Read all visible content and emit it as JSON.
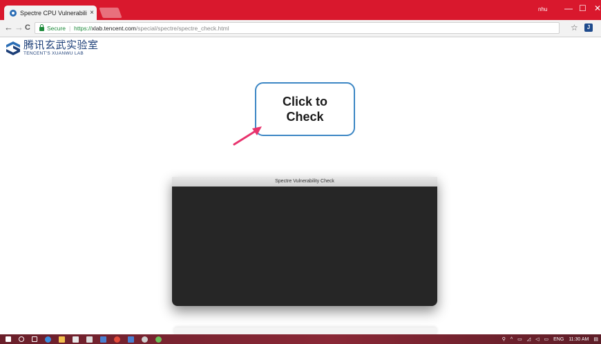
{
  "browser": {
    "tab_title": "Spectre CPU Vulnerabilit",
    "tab_close": "×",
    "user": "nhu",
    "minimize": "—",
    "maximize": "☐",
    "close": "✕",
    "nav": {
      "back": "←",
      "forward": "→",
      "reload": "C"
    },
    "secure_label": "Secure",
    "separator": "|",
    "url_scheme": "https://",
    "url_host": "xlab.tencent.com",
    "url_path": "/special/spectre/spectre_check.html",
    "star": "☆",
    "extension_label": "J"
  },
  "page": {
    "logo_cn": "腾讯玄武实验室",
    "logo_en": "TENCENT'S XUANWU LAB",
    "callout_text": "Click to Check",
    "app_window_title": "Spectre Vulnerability Check"
  },
  "taskbar": {
    "language": "ENG",
    "time": "11:30 AM"
  },
  "colors": {
    "titlebar": "#d9182d",
    "callout_border": "#3b86c4",
    "arrow": "#e8336d",
    "app_window_bg": "#262626"
  },
  "icons": [
    "windows-start-icon",
    "cortana-icon",
    "task-view-icon",
    "edge-icon",
    "file-explorer-icon",
    "store-icon",
    "mail-icon",
    "app-icon",
    "chrome-icon",
    "app-icon-2",
    "settings-icon",
    "app-icon-3"
  ]
}
